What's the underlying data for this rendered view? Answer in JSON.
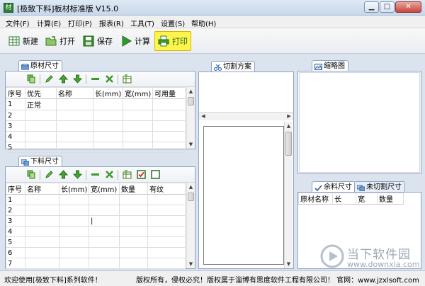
{
  "window": {
    "title": "[极致下料]板材标准版 V15.0",
    "icon_text": "材",
    "minimize_glyph": "▁",
    "maximize_glyph": "□",
    "close_glyph": "✕"
  },
  "menu": [
    "文件(F)",
    "计算(E)",
    "打印(P)",
    "报表(R)",
    "工具(T)",
    "设置(S)",
    "帮助(H)"
  ],
  "toolbar": {
    "new_label": "新建",
    "open_label": "打开",
    "save_label": "保存",
    "calc_label": "计算",
    "print_label": "打印"
  },
  "raw_panel": {
    "tab_label": "原材尺寸",
    "headers": [
      "序号",
      "优先",
      "名称",
      "长(mm)",
      "宽(mm)",
      "可用量"
    ],
    "rows": [
      [
        "1",
        "正常",
        "",
        "",
        "",
        ""
      ],
      [
        "2",
        "",
        "",
        "",
        "",
        ""
      ],
      [
        "3",
        "",
        "",
        "",
        "",
        ""
      ],
      [
        "4",
        "",
        "",
        "",
        "",
        ""
      ],
      [
        "5",
        "",
        "",
        "",
        "",
        ""
      ]
    ]
  },
  "cut_panel": {
    "tab_label": "下料尺寸",
    "headers": [
      "序号",
      "名称",
      "长(mm)",
      "宽(mm)",
      "数量",
      "有纹"
    ],
    "rows": [
      [
        "1",
        "",
        "",
        "",
        "",
        ""
      ],
      [
        "2",
        "",
        "",
        "",
        "",
        ""
      ],
      [
        "3",
        "",
        "",
        "|",
        "",
        ""
      ],
      [
        "4",
        "",
        "",
        "",
        "",
        ""
      ],
      [
        "5",
        "",
        "",
        "",
        "",
        ""
      ],
      [
        "6",
        "",
        "",
        "",
        "",
        ""
      ],
      [
        "7",
        "",
        "",
        "",
        "",
        ""
      ]
    ]
  },
  "plan_panel": {
    "tab_label": "切割方案"
  },
  "thumb_panel": {
    "tab_label": "缩略图"
  },
  "remain_panel": {
    "tab_label": "余料尺寸",
    "tab2_label": "未切割尺寸",
    "headers": [
      "原材名称",
      "长",
      "宽",
      "数量"
    ]
  },
  "status": {
    "left": "欢迎使用[极致下料]系列软件！",
    "right": "版权所有，侵权必究！版权属于淄博有思度软件工程有限公司！ 官网：www.jzxlsoft.com"
  },
  "watermark": {
    "text1": "当下软件园",
    "text2": "www.downxia.com"
  },
  "colors": {
    "accent": "#2e7d32",
    "highlight": "#fff34d",
    "panel_border": "#8ea3c2"
  }
}
